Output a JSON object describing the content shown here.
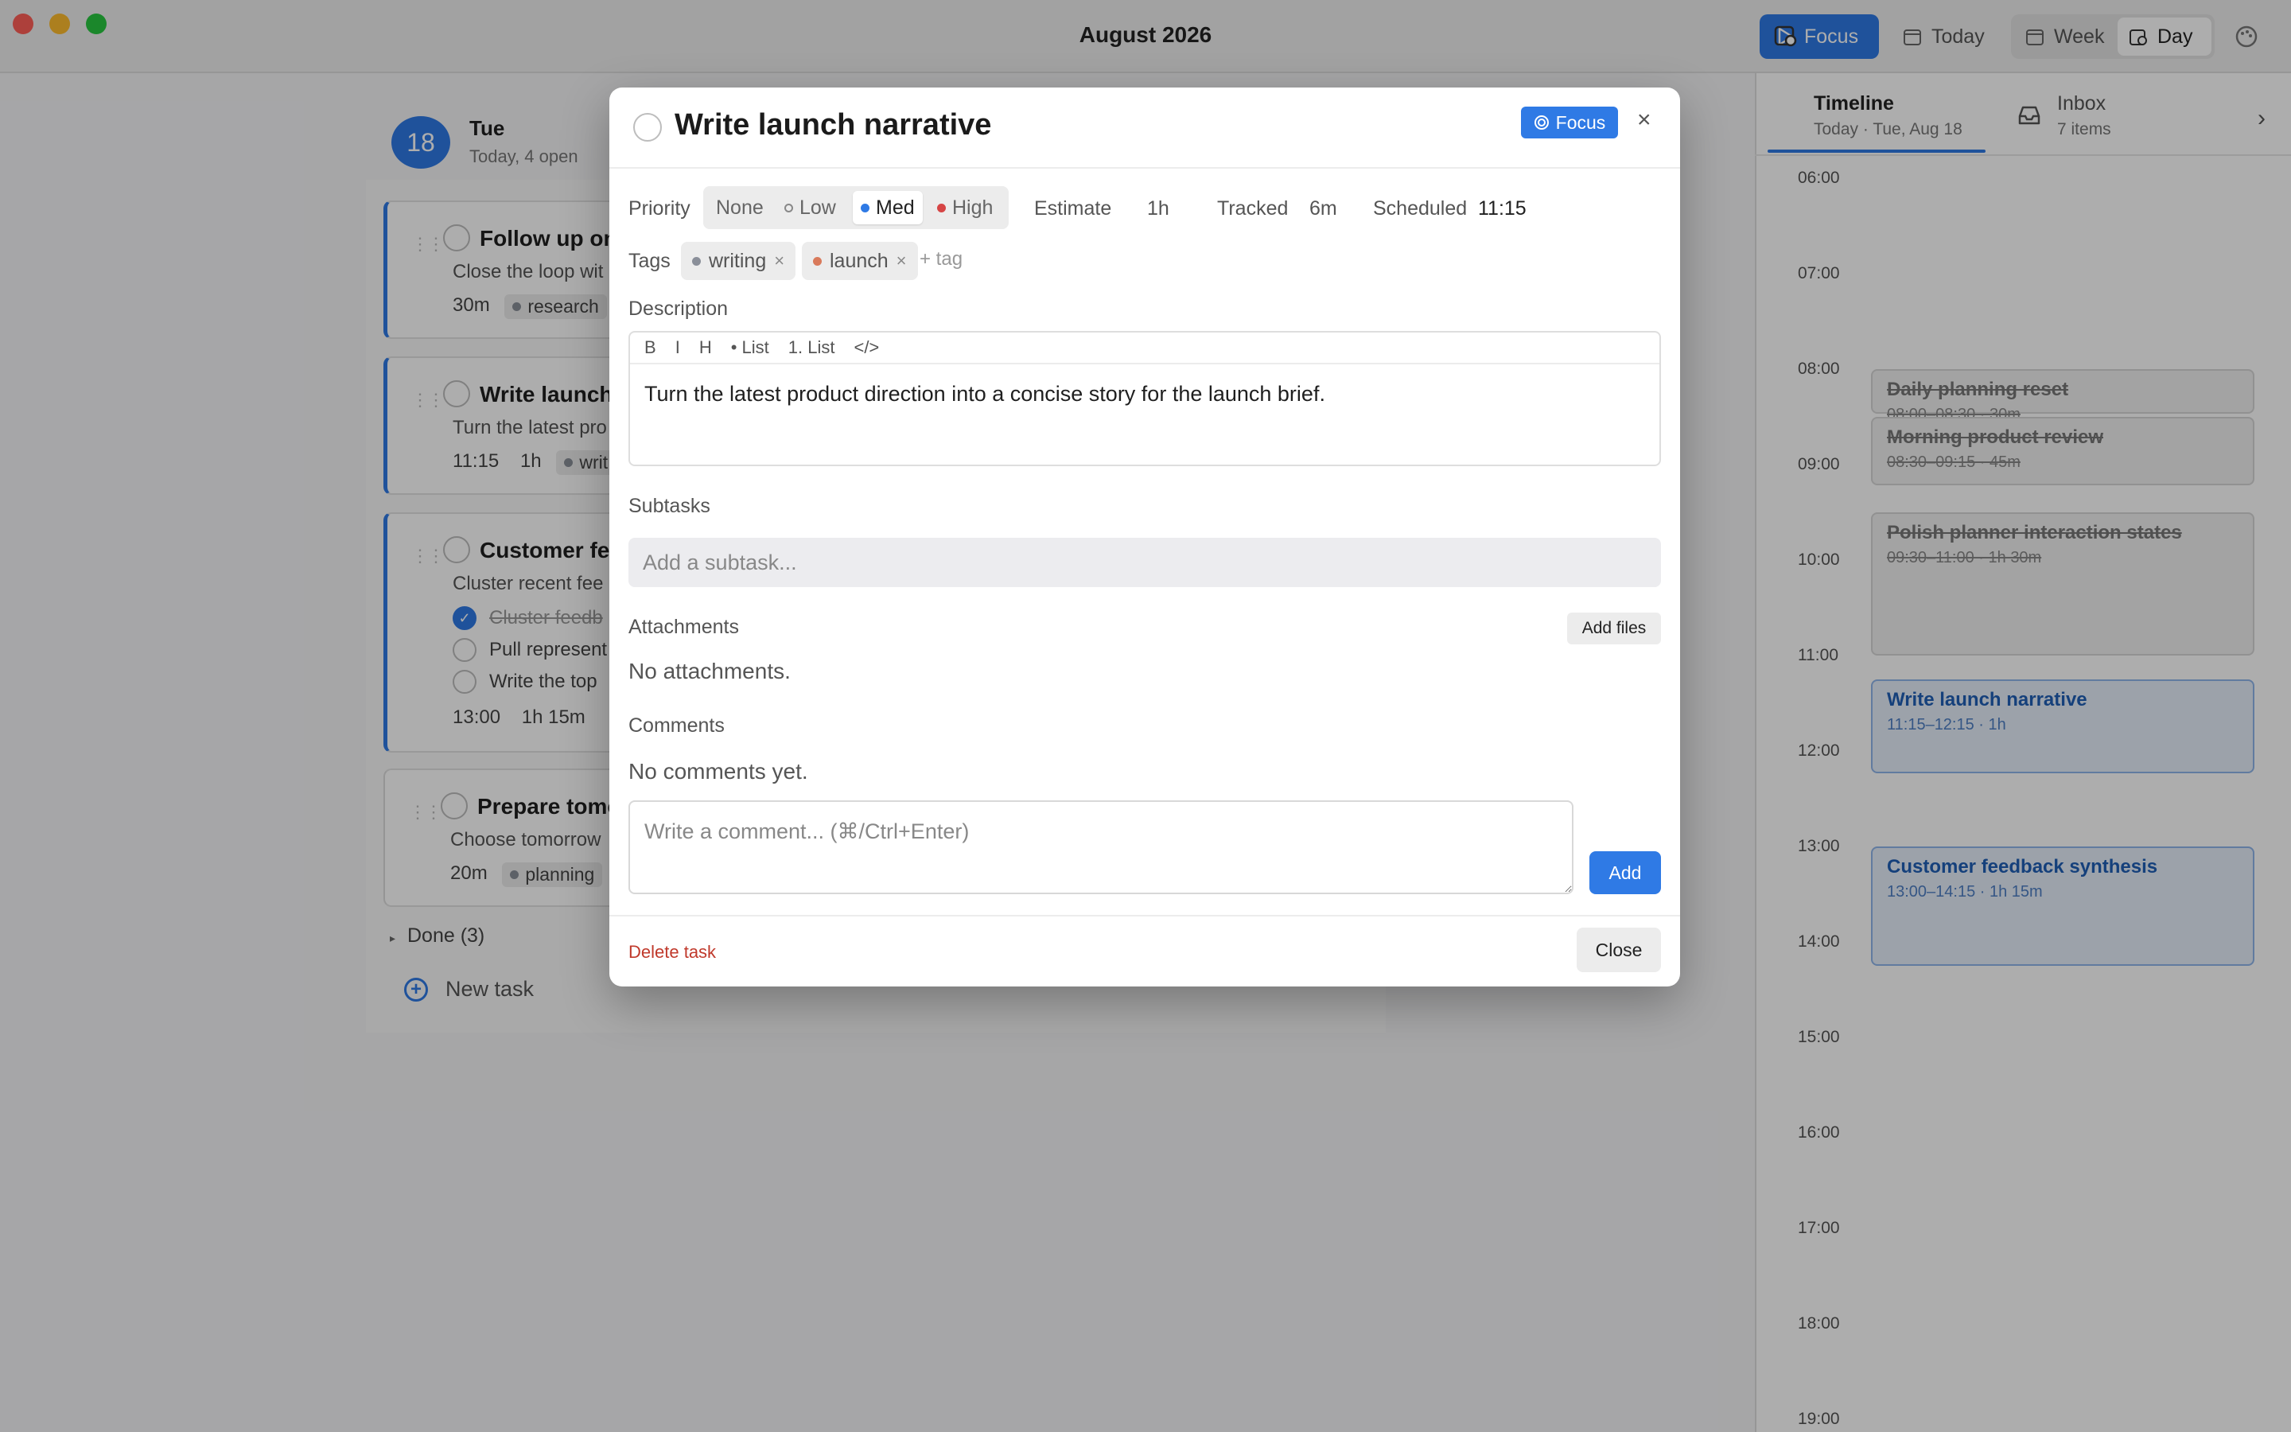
{
  "window": {
    "title": "August 2026"
  },
  "toolbar": {
    "focus_label": "Focus",
    "today_label": "Today",
    "week_label": "Week",
    "day_label": "Day"
  },
  "day_header": {
    "date_number": "18",
    "day_name": "Tue",
    "summary": "Today, 4 open"
  },
  "tasks": [
    {
      "title": "Follow up on",
      "description": "Close the loop wit",
      "meta": "30m",
      "tag": "research"
    },
    {
      "title": "Write launch",
      "description": "Turn the latest pro",
      "meta_time": "11:15",
      "meta_est": "1h",
      "tag": "writ"
    },
    {
      "title": "Customer fee",
      "description": "Cluster recent fee",
      "subtasks": [
        "Cluster feedb",
        "Pull represent",
        "Write the top"
      ],
      "meta_time": "13:00",
      "meta_est": "1h 15m"
    },
    {
      "title": "Prepare tomo",
      "description": "Choose tomorrow",
      "meta": "20m",
      "tag": "planning"
    }
  ],
  "done_toggle": "Done (3)",
  "new_task_label": "New task",
  "sidebar": {
    "tabs": [
      {
        "label": "Timeline",
        "sub": "Today · Tue, Aug 18"
      },
      {
        "label": "Inbox",
        "sub": "7 items"
      }
    ],
    "hours": [
      "06:00",
      "07:00",
      "08:00",
      "09:00",
      "10:00",
      "11:00",
      "12:00",
      "13:00",
      "14:00",
      "15:00",
      "16:00",
      "17:00",
      "18:00",
      "19:00"
    ],
    "events": [
      {
        "title": "Daily planning reset",
        "time": "08:00–08:30 · 30m"
      },
      {
        "title": "Morning product review",
        "time": "08:30–09:15 · 45m"
      },
      {
        "title": "Polish planner interaction states",
        "time": "09:30–11:00 · 1h 30m"
      },
      {
        "title": "Write launch narrative",
        "time": "11:15–12:15 · 1h"
      },
      {
        "title": "Customer feedback synthesis",
        "time": "13:00–14:15 · 1h 15m"
      }
    ]
  },
  "modal": {
    "title": "Write launch narrative",
    "focus_badge": "Focus",
    "close_x": "×",
    "priority_label": "Priority",
    "priority_options": [
      "None",
      "Low",
      "Med",
      "High"
    ],
    "priority_selected": "Med",
    "estimate_label": "Estimate",
    "estimate_value": "1h",
    "tracked_label": "Tracked",
    "tracked_value": "6m",
    "scheduled_label": "Scheduled",
    "scheduled_value": "11:15",
    "tags_label": "Tags",
    "tags": [
      "writing",
      "launch"
    ],
    "add_tag_placeholder": "+ tag",
    "description_label": "Description",
    "editor_tools": [
      "B",
      "I",
      "H",
      "• List",
      "1. List",
      "</>"
    ],
    "description_text": "Turn the latest product direction into a concise story for the launch brief.",
    "subtasks_label": "Subtasks",
    "subtask_placeholder": "Add a subtask...",
    "attachments_label": "Attachments",
    "add_files_label": "Add files",
    "no_attachments": "No attachments.",
    "comments_label": "Comments",
    "no_comments": "No comments yet.",
    "comment_placeholder": "Write a comment... (⌘/Ctrl+Enter)",
    "add_comment_label": "Add",
    "delete_label": "Delete task",
    "close_label": "Close"
  },
  "colors": {
    "accent": "#2f7ae5",
    "danger": "#c0392b",
    "tag_writing": "#8a8f99",
    "tag_launch": "#d97a5b",
    "prio_med": "#2f7ae5",
    "prio_high": "#d64545"
  }
}
